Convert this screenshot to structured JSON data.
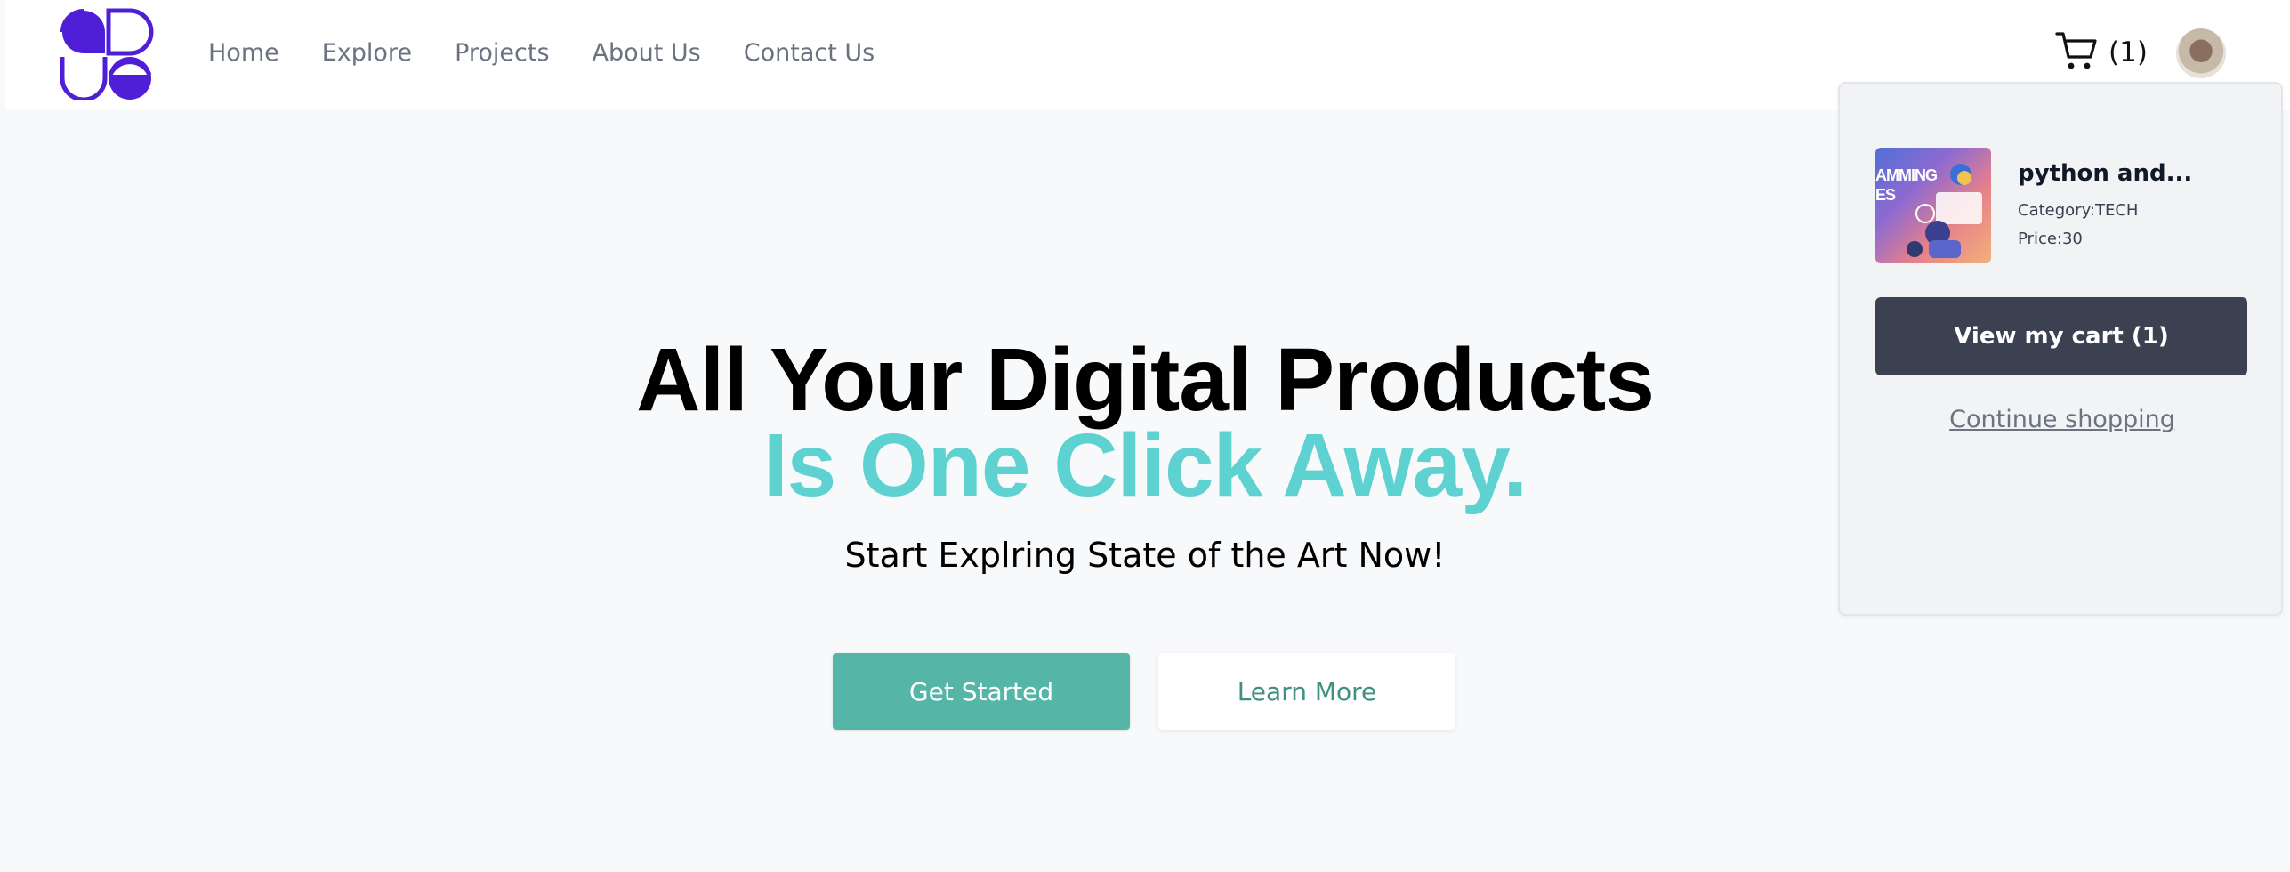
{
  "brand": {
    "logo_icon": "logo-icon",
    "color": "#4f1fd8"
  },
  "nav": {
    "links": [
      "Home",
      "Explore",
      "Projects",
      "About Us",
      "Contact Us"
    ]
  },
  "header": {
    "cart_icon": "cart-icon",
    "cart_count": "(1)",
    "avatar_icon": "user-avatar"
  },
  "cart_panel": {
    "item": {
      "thumbnail_text": "AMMING\nES",
      "name": "python and...",
      "category": "Category:TECH",
      "price": "Price:30"
    },
    "view_cart_label": "View my cart (1)",
    "continue_label": "Continue shopping"
  },
  "hero": {
    "title_line1": "All Your Digital Products",
    "title_line2": "Is One Click Away.",
    "subtitle": "Start Explring State of the Art Now!",
    "primary_button": "Get Started",
    "secondary_button": "Learn More",
    "accent_color": "#5ed2d0",
    "button_color": "#55b5a6"
  }
}
